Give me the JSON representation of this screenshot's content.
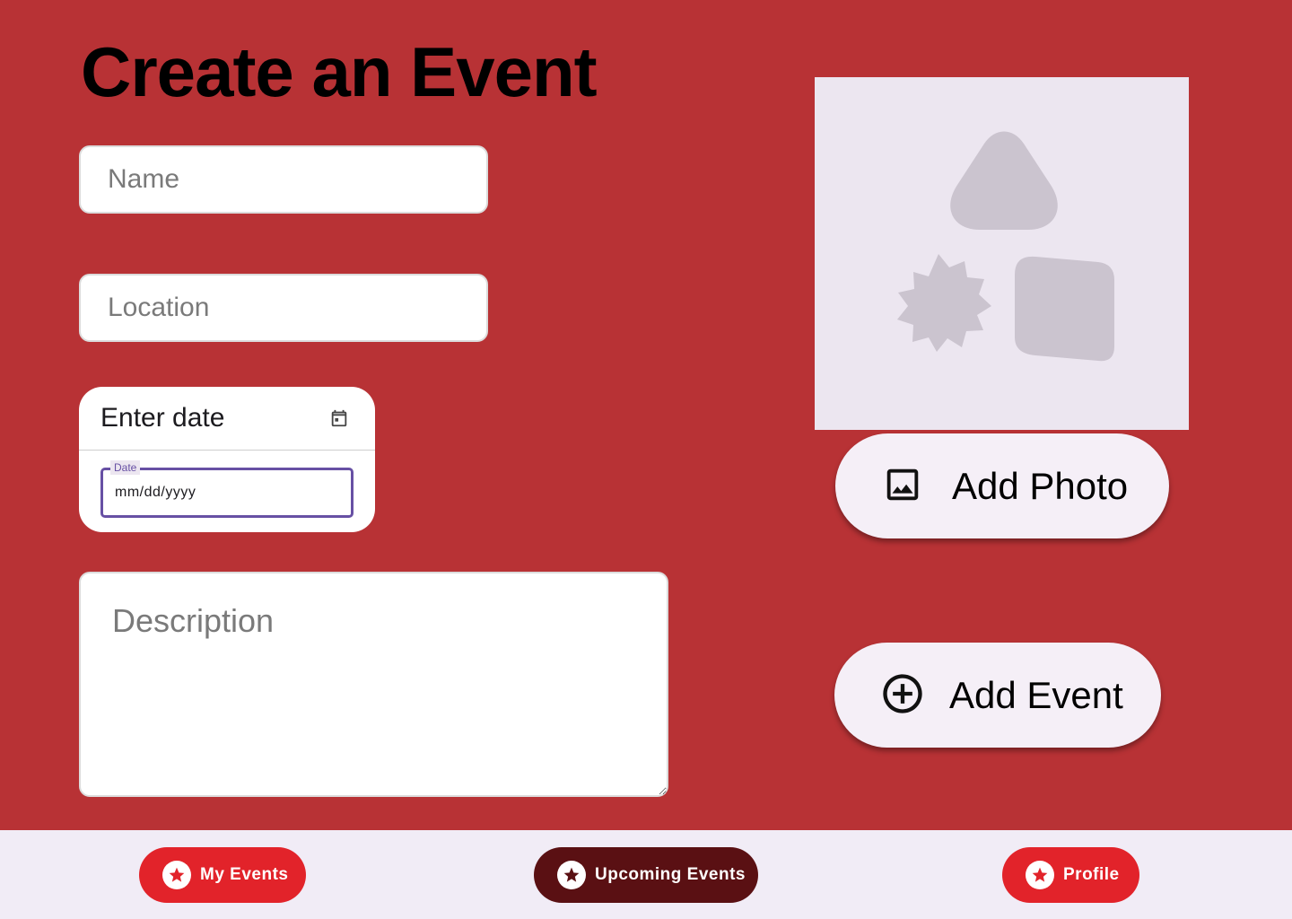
{
  "page": {
    "title": "Create an Event",
    "background_color": "#b83235"
  },
  "form": {
    "name_placeholder": "Name",
    "location_placeholder": "Location",
    "date": {
      "header_label": "Enter date",
      "field_label": "Date",
      "placeholder": "mm/dd/yyyy",
      "icon": "calendar-icon",
      "accent_color": "#6750a4"
    },
    "description_placeholder": "Description"
  },
  "media": {
    "placeholder_icon": "image-placeholder-shapes",
    "add_photo_label": "Add Photo",
    "add_photo_icon": "image-icon"
  },
  "actions": {
    "add_event_label": "Add Event",
    "add_event_icon": "add-circle-icon"
  },
  "bottom_nav": {
    "items": [
      {
        "label": "My Events",
        "icon": "star-icon",
        "color": "#e2232a"
      },
      {
        "label": "Upcoming Events",
        "icon": "star-icon",
        "color": "#5a1013",
        "active": true
      },
      {
        "label": "Profile",
        "icon": "star-icon",
        "color": "#e2232a"
      }
    ]
  }
}
